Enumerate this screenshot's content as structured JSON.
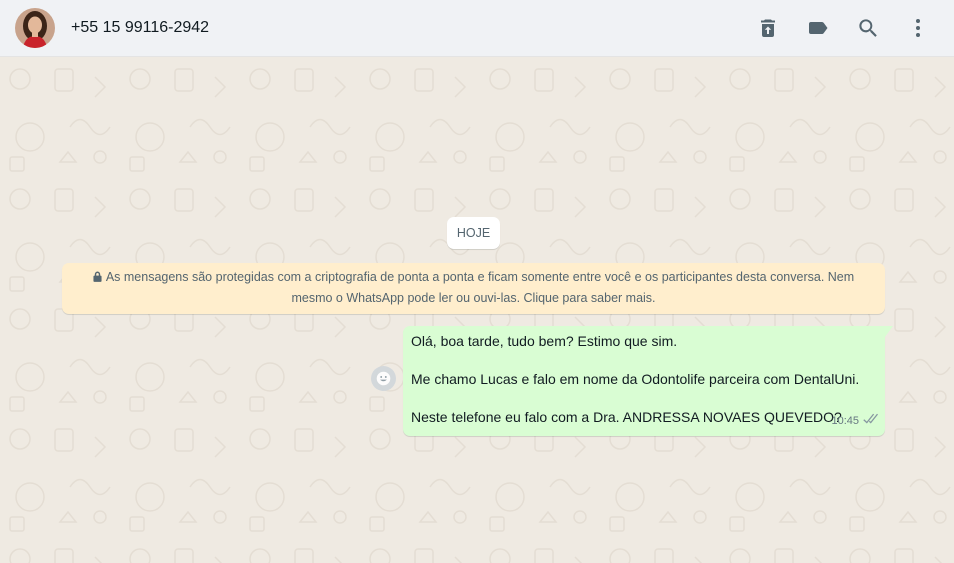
{
  "header": {
    "contact_name": "+55 15 99116-2942",
    "icons": [
      "delete-icon",
      "label-icon",
      "search-icon",
      "menu-icon"
    ]
  },
  "chat": {
    "date_chip": "HOJE",
    "encryption_notice": "As mensagens são protegidas com a criptografia de ponta a ponta e ficam somente entre você e os participantes desta conversa. Nem mesmo o WhatsApp pode ler ou ouvi-las. Clique para saber mais.",
    "message": {
      "line1": "Olá, boa tarde, tudo bem? Estimo que sim.",
      "line2": "Me chamo Lucas e falo em nome da Odontolife parceira com DentalUni.",
      "line3": "Neste telefone eu falo com a Dra. ANDRESSA NOVAES QUEVEDO?",
      "time": "10:45",
      "status": "delivered"
    }
  },
  "colors": {
    "header_bg": "#f0f2f5",
    "chat_bg": "#efeae2",
    "outgoing_bubble": "#d9fdd3",
    "system_notice": "#ffeecd"
  }
}
